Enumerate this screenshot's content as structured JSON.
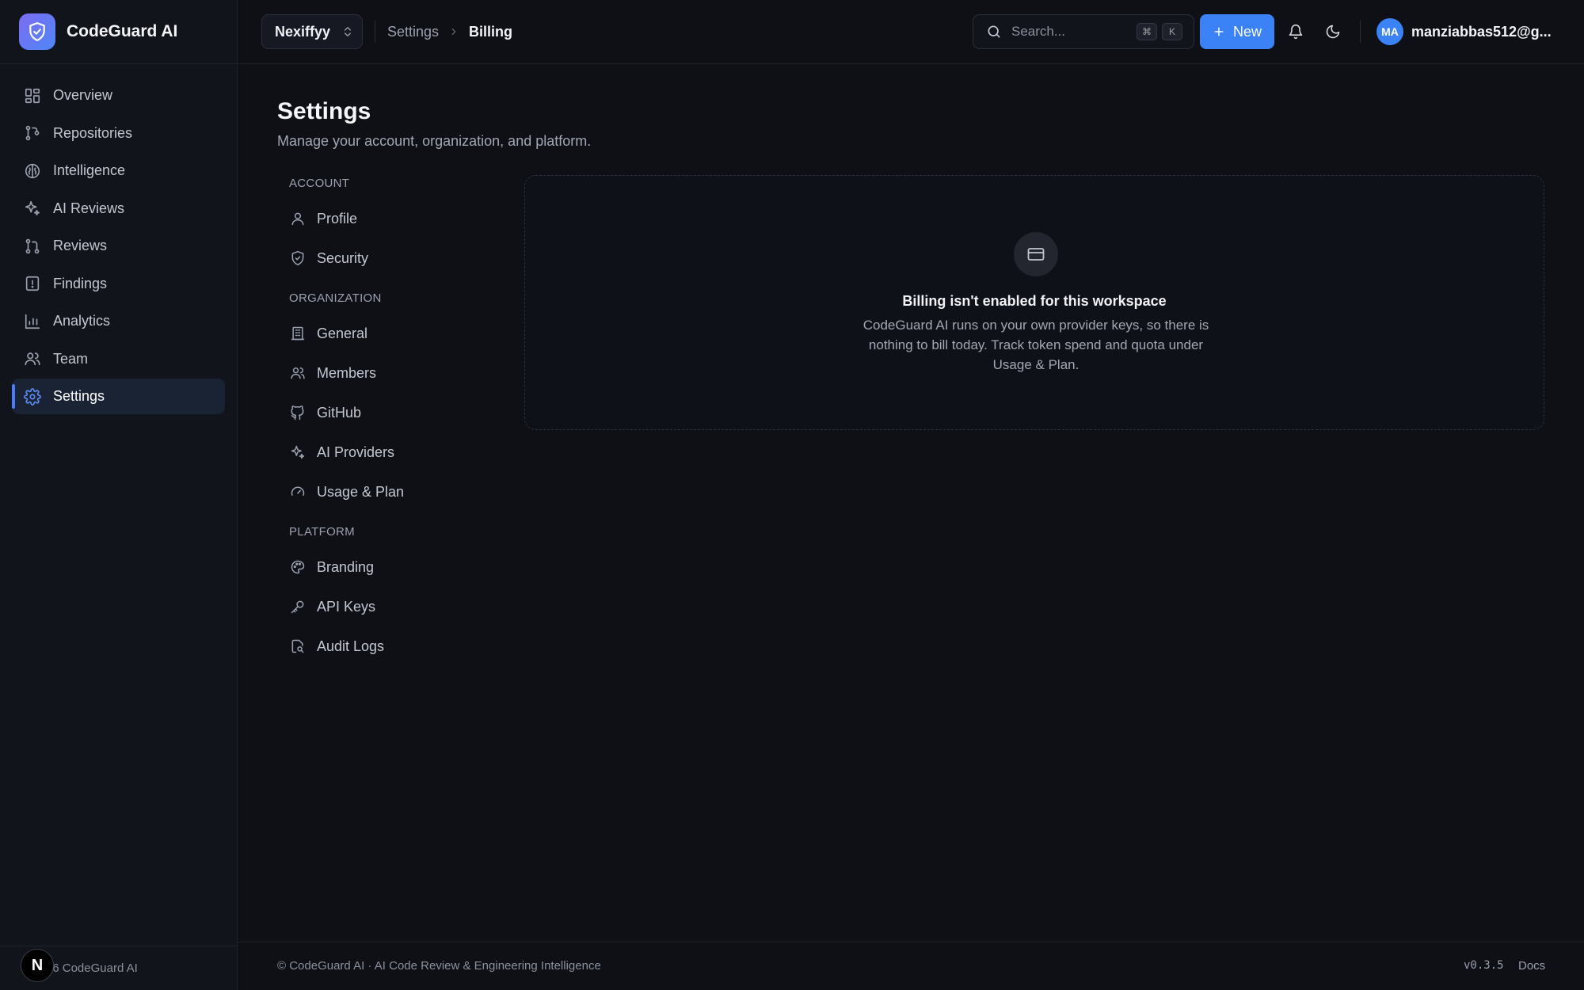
{
  "brand": {
    "name": "CodeGuard AI"
  },
  "sidebar": {
    "items": [
      {
        "label": "Overview",
        "icon": "dashboard-icon"
      },
      {
        "label": "Repositories",
        "icon": "git-branch-icon"
      },
      {
        "label": "Intelligence",
        "icon": "brain-icon"
      },
      {
        "label": "AI Reviews",
        "icon": "sparkles-icon"
      },
      {
        "label": "Reviews",
        "icon": "git-pull-request-icon"
      },
      {
        "label": "Findings",
        "icon": "file-alert-icon"
      },
      {
        "label": "Analytics",
        "icon": "bar-chart-icon"
      },
      {
        "label": "Team",
        "icon": "users-icon"
      },
      {
        "label": "Settings",
        "icon": "gear-icon",
        "active": true
      }
    ],
    "footer": "© 2026 CodeGuard AI",
    "badge": "N"
  },
  "header": {
    "workspace": "Nexiffyy",
    "breadcrumb": [
      "Settings",
      "Billing"
    ],
    "search": {
      "placeholder": "Search...",
      "shortcut": [
        "⌘",
        "K"
      ]
    },
    "new_label": "New",
    "user": {
      "initials": "MA",
      "email": "manziabbas512@g..."
    }
  },
  "page": {
    "title": "Settings",
    "subtitle": "Manage your account, organization, and platform."
  },
  "settings_nav": {
    "account": {
      "title": "ACCOUNT",
      "items": [
        "Profile",
        "Security"
      ]
    },
    "organization": {
      "title": "ORGANIZATION",
      "items": [
        "General",
        "Members",
        "GitHub",
        "AI Providers",
        "Usage & Plan"
      ]
    },
    "platform": {
      "title": "PLATFORM",
      "items": [
        "Branding",
        "API Keys",
        "Audit Logs"
      ]
    }
  },
  "billing": {
    "title": "Billing isn't enabled for this workspace",
    "description": "CodeGuard AI runs on your own provider keys, so there is nothing to bill today. Track token spend and quota under Usage & Plan."
  },
  "footer": {
    "left": "© CodeGuard AI · AI Code Review & Engineering Intelligence",
    "version": "v0.3.5",
    "docs": "Docs"
  },
  "colors": {
    "accent": "#3b82f6",
    "background": "#0e1016",
    "sidebar": "#12141b",
    "active_item": "#1a2333"
  }
}
